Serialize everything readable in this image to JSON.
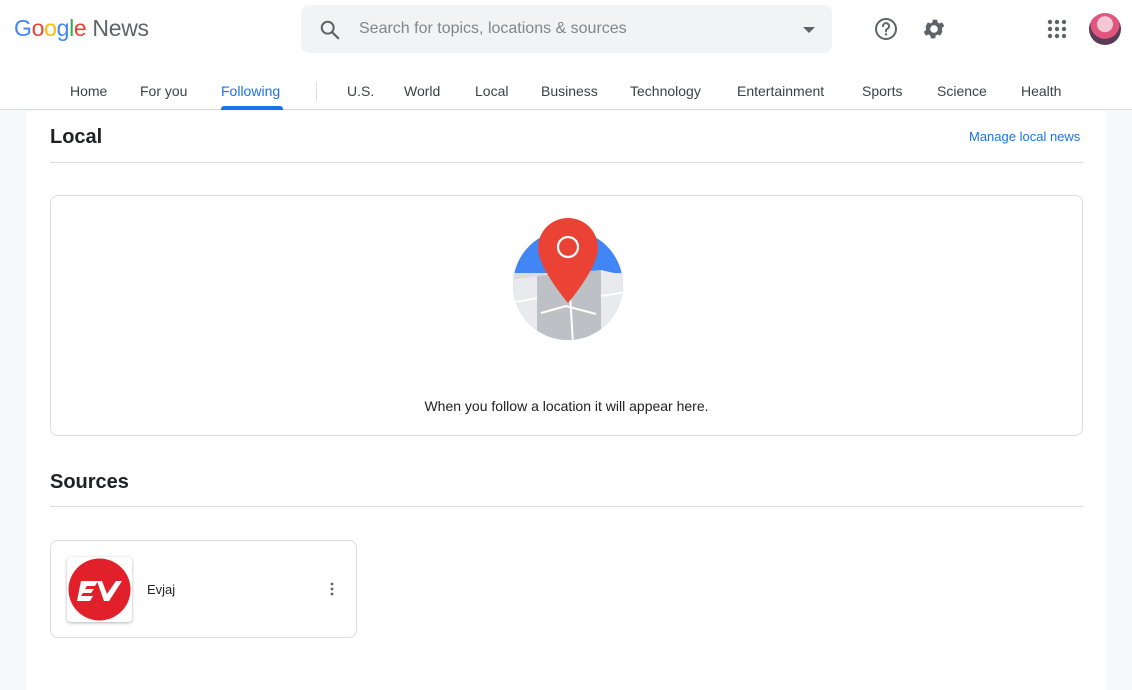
{
  "header": {
    "logo": {
      "g1": "G",
      "o1": "o",
      "o2": "o",
      "g2": "g",
      "l": "l",
      "e": "e",
      "product": "News"
    },
    "search": {
      "placeholder": "Search for topics, locations & sources",
      "icon": "search-icon"
    },
    "icons": {
      "help": "help-icon",
      "settings": "gear-icon",
      "apps": "apps-grid-icon"
    }
  },
  "nav": {
    "tabs": [
      {
        "label": "Home"
      },
      {
        "label": "For you"
      },
      {
        "label": "Following",
        "active": true
      },
      {
        "label": "U.S."
      },
      {
        "label": "World"
      },
      {
        "label": "Local"
      },
      {
        "label": "Business"
      },
      {
        "label": "Technology"
      },
      {
        "label": "Entertainment"
      },
      {
        "label": "Sports"
      },
      {
        "label": "Science"
      },
      {
        "label": "Health"
      }
    ]
  },
  "local": {
    "title": "Local",
    "manage_link": "Manage local news",
    "empty_message": "When you follow a location it will appear here."
  },
  "sources": {
    "title": "Sources",
    "items": [
      {
        "name": "Evjaj",
        "logo_color": "#e2202b"
      }
    ]
  },
  "colors": {
    "accent": "#1a73e8",
    "pin": "#ea4335",
    "map_blue": "#4285f4"
  }
}
